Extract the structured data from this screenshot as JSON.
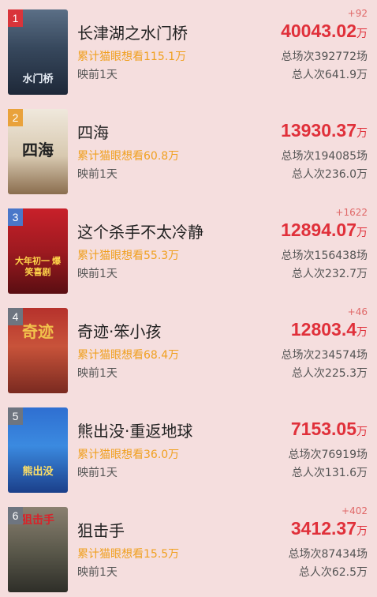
{
  "movies": [
    {
      "rank": "1",
      "title": "长津湖之水门桥",
      "want": "累计猫眼想看115.1万",
      "release": "映前1天",
      "delta": "+92",
      "box_value": "40043.02",
      "box_unit": "万",
      "shows": "总场次392772场",
      "people": "总人次641.9万",
      "rank_color": "#d9343a",
      "poster_text": "水门桥"
    },
    {
      "rank": "2",
      "title": "四海",
      "want": "累计猫眼想看60.8万",
      "release": "映前1天",
      "delta": "",
      "box_value": "13930.37",
      "box_unit": "万",
      "shows": "总场次194085场",
      "people": "总人次236.0万",
      "rank_color": "#e9a23b",
      "poster_text": "四海"
    },
    {
      "rank": "3",
      "title": "这个杀手不太冷静",
      "want": "累计猫眼想看55.3万",
      "release": "映前1天",
      "delta": "+1622",
      "box_value": "12894.07",
      "box_unit": "万",
      "shows": "总场次156438场",
      "people": "总人次232.7万",
      "rank_color": "#4a77c9",
      "poster_text": "大年初一 爆笑喜剧"
    },
    {
      "rank": "4",
      "title": "奇迹·笨小孩",
      "want": "累计猫眼想看68.4万",
      "release": "映前1天",
      "delta": "+46",
      "box_value": "12803.4",
      "box_unit": "万",
      "shows": "总场次234574场",
      "people": "总人次225.3万",
      "rank_color": "#6e7580",
      "poster_text": "奇迹"
    },
    {
      "rank": "5",
      "title": "熊出没·重返地球",
      "want": "累计猫眼想看36.0万",
      "release": "映前1天",
      "delta": "",
      "box_value": "7153.05",
      "box_unit": "万",
      "shows": "总场次76919场",
      "people": "总人次131.6万",
      "rank_color": "#6e7580",
      "poster_text": "熊出没"
    },
    {
      "rank": "6",
      "title": "狙击手",
      "want": "累计猫眼想看15.5万",
      "release": "映前1天",
      "delta": "+402",
      "box_value": "3412.37",
      "box_unit": "万",
      "shows": "总场次87434场",
      "people": "总人次62.5万",
      "rank_color": "#6e7580",
      "poster_text": "狙击手"
    }
  ]
}
